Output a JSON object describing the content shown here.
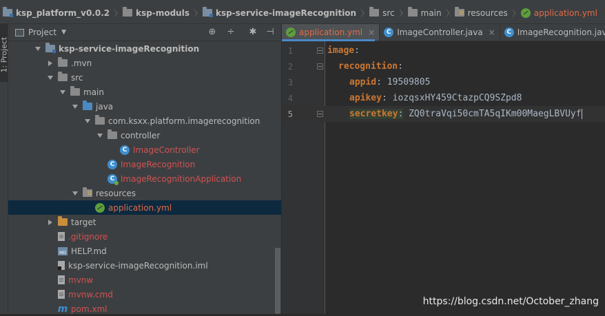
{
  "breadcrumbs": [
    {
      "label": "ksp_platform_v0.0.2",
      "icon": "module-folder-icon",
      "bold": true
    },
    {
      "label": "ksp-moduls",
      "icon": "folder-icon",
      "bold": true
    },
    {
      "label": "ksp-service-imageRecognition",
      "icon": "module-folder-icon",
      "bold": true
    },
    {
      "label": "src",
      "icon": "folder-icon",
      "bold": false
    },
    {
      "label": "main",
      "icon": "folder-icon",
      "bold": false
    },
    {
      "label": "resources",
      "icon": "resources-folder-icon",
      "bold": false
    },
    {
      "label": "application.yml",
      "icon": "spring-yml-icon",
      "bold": false
    }
  ],
  "side_strip": {
    "label": "1: Project"
  },
  "project_panel": {
    "title": "Project",
    "toolbar_icons": [
      "locate-icon",
      "collapse-icon",
      "gear-icon",
      "hide-icon"
    ],
    "tree": [
      {
        "label": "ksp-service-imageRecognition",
        "icon": "module-folder",
        "arrow": "down",
        "bold": true,
        "color": "normal"
      },
      {
        "label": ".mvn",
        "icon": "folder",
        "arrow": "right",
        "bold": false,
        "color": "normal"
      },
      {
        "label": "src",
        "icon": "folder",
        "arrow": "down",
        "bold": false,
        "color": "normal"
      },
      {
        "label": "main",
        "icon": "folder",
        "arrow": "down",
        "bold": false,
        "color": "normal"
      },
      {
        "label": "java",
        "icon": "source-folder",
        "arrow": "down",
        "bold": false,
        "color": "normal"
      },
      {
        "label": "com.ksxx.platform.imagerecognition",
        "icon": "package",
        "arrow": "down",
        "bold": false,
        "color": "normal"
      },
      {
        "label": "controller",
        "icon": "package",
        "arrow": "down",
        "bold": false,
        "color": "normal"
      },
      {
        "label": "ImageController",
        "icon": "class",
        "arrow": "none",
        "bold": false,
        "color": "red"
      },
      {
        "label": "ImageRecognition",
        "icon": "class",
        "arrow": "none",
        "bold": false,
        "color": "red"
      },
      {
        "label": "ImageRecognitionApplication",
        "icon": "spring-class",
        "arrow": "none",
        "bold": false,
        "color": "red"
      },
      {
        "label": "resources",
        "icon": "resources-folder",
        "arrow": "down",
        "bold": false,
        "color": "normal"
      },
      {
        "label": "application.yml",
        "icon": "spring-yml",
        "arrow": "none",
        "bold": false,
        "color": "orange",
        "selected": true
      },
      {
        "label": "target",
        "icon": "excluded-folder",
        "arrow": "right",
        "bold": false,
        "color": "normal"
      },
      {
        "label": ".gitignore",
        "icon": "text-file",
        "arrow": "none",
        "bold": false,
        "color": "red"
      },
      {
        "label": "HELP.md",
        "icon": "markdown-file",
        "arrow": "none",
        "bold": false,
        "color": "normal"
      },
      {
        "label": "ksp-service-imageRecognition.iml",
        "icon": "iml-file",
        "arrow": "none",
        "bold": false,
        "color": "normal"
      },
      {
        "label": "mvnw",
        "icon": "text-file",
        "arrow": "none",
        "bold": false,
        "color": "red"
      },
      {
        "label": "mvnw.cmd",
        "icon": "text-file",
        "arrow": "none",
        "bold": false,
        "color": "red"
      },
      {
        "label": "pom.xml",
        "icon": "maven-file",
        "arrow": "none",
        "bold": false,
        "color": "red"
      }
    ]
  },
  "editor_tabs": [
    {
      "label": "application.yml",
      "icon": "spring-yml",
      "active": true,
      "close": "×"
    },
    {
      "label": "ImageController.java",
      "icon": "class",
      "active": false,
      "close": "×"
    },
    {
      "label": "ImageRecognition.java",
      "icon": "class",
      "active": false,
      "close": ""
    }
  ],
  "code_lines": [
    {
      "num": "1",
      "key": "image",
      "sep": ":",
      "value": "",
      "indent": 0
    },
    {
      "num": "2",
      "key": "recognition",
      "sep": ":",
      "value": "",
      "indent": 1
    },
    {
      "num": "3",
      "key": "appid",
      "sep": ":",
      "value": " 19509805",
      "indent": 2
    },
    {
      "num": "4",
      "key": "apikey",
      "sep": ":",
      "value": " iozqsxHY459CtazpCQ9SZpd8",
      "indent": 2
    },
    {
      "num": "5",
      "key": "secretkey",
      "sep": ":",
      "value": " ZQ0traVqi50cmTA5qIKm00MaegLBVUyf",
      "indent": 2
    }
  ],
  "watermark": "https://blog.csdn.net/October_zhang",
  "colors": {
    "accent": "#4a88c7",
    "selection": "#0d293e",
    "key": "#cc7832",
    "modified": "#e06c4a",
    "unversioned": "#d25252"
  }
}
